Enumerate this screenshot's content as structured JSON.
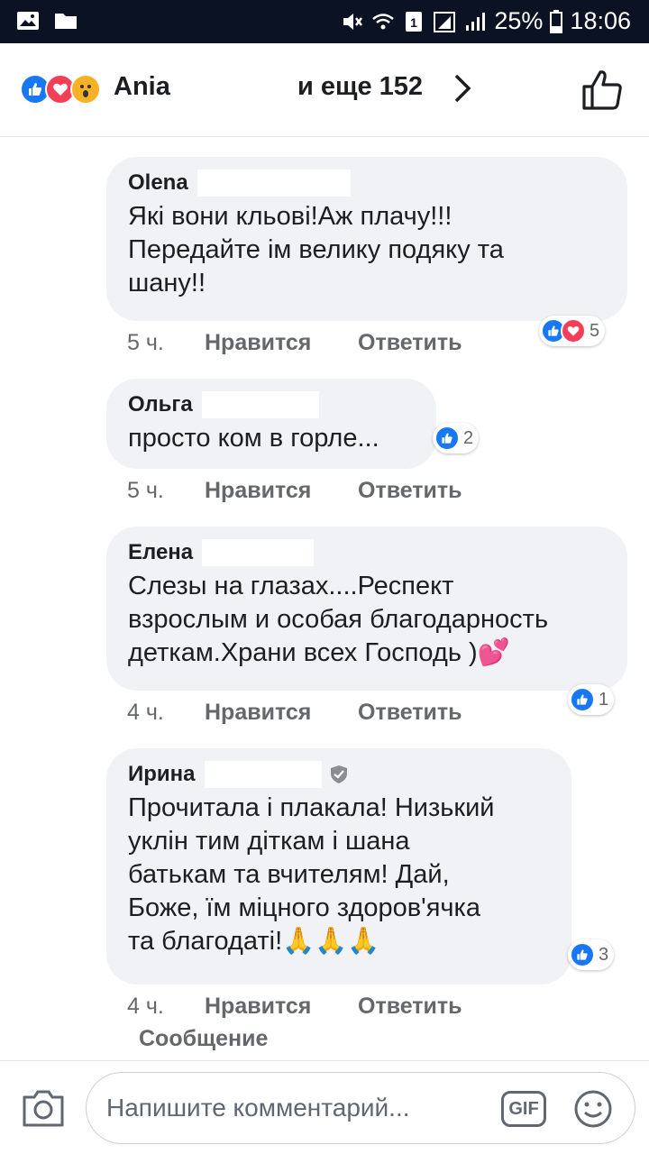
{
  "status_bar": {
    "battery": "25%",
    "time": "18:06",
    "icons": [
      "gallery-icon",
      "folder-icon",
      "mute-icon",
      "wifi-icon",
      "sim-1-icon",
      "signal-icon",
      "battery-icon"
    ]
  },
  "reactions_header": {
    "icons": [
      "like-reaction-icon",
      "love-reaction-icon",
      "wow-reaction-icon"
    ],
    "name": "Ania",
    "others": "и еще 152",
    "like_icon": "thumbs-up-icon"
  },
  "comments": [
    {
      "author": "Olena",
      "text": "Які вони кльові!Аж плачу!!!\nПередайте ім велику подяку та\nшану!!",
      "time": "5 ч.",
      "like": "Нравится",
      "reply": "Ответить",
      "reaction_count": "5",
      "reactions": [
        "like",
        "love"
      ]
    },
    {
      "author": "Ольга",
      "text": "просто ком в горле...",
      "time": "5 ч.",
      "like": "Нравится",
      "reply": "Ответить",
      "reaction_count": "2",
      "reactions": [
        "like"
      ]
    },
    {
      "author": "Елена",
      "text": "Слезы на глазах....Респект\nвзрослым и особая благодарность\nдеткам.Храни всех Господь )💕",
      "time": "4 ч.",
      "like": "Нравится",
      "reply": "Ответить",
      "reaction_count": "1",
      "reactions": [
        "like"
      ]
    },
    {
      "author": "Ирина",
      "text": "Прочитала і плакала! Низький\nуклін тим діткам і шана\nбатькам та вчителям! Дай,\nБоже, їм міцного здоров'ячка\nта благодаті!🙏🙏🙏",
      "time": "4 ч.",
      "like": "Нравится",
      "reply": "Ответить",
      "reaction_count": "3",
      "reactions": [
        "like"
      ],
      "badge_icon": "shield-icon"
    }
  ],
  "message_label": "Сообщение",
  "composer": {
    "placeholder": "Напишите комментарий...",
    "gif_label": "GIF",
    "camera_icon": "camera-icon",
    "emoji_icon": "smile-icon"
  },
  "colors": {
    "like_blue": "#1877f2",
    "love_red": "#f33e58",
    "bubble_bg": "#f0f2f5",
    "meta_gray": "#65676b"
  }
}
